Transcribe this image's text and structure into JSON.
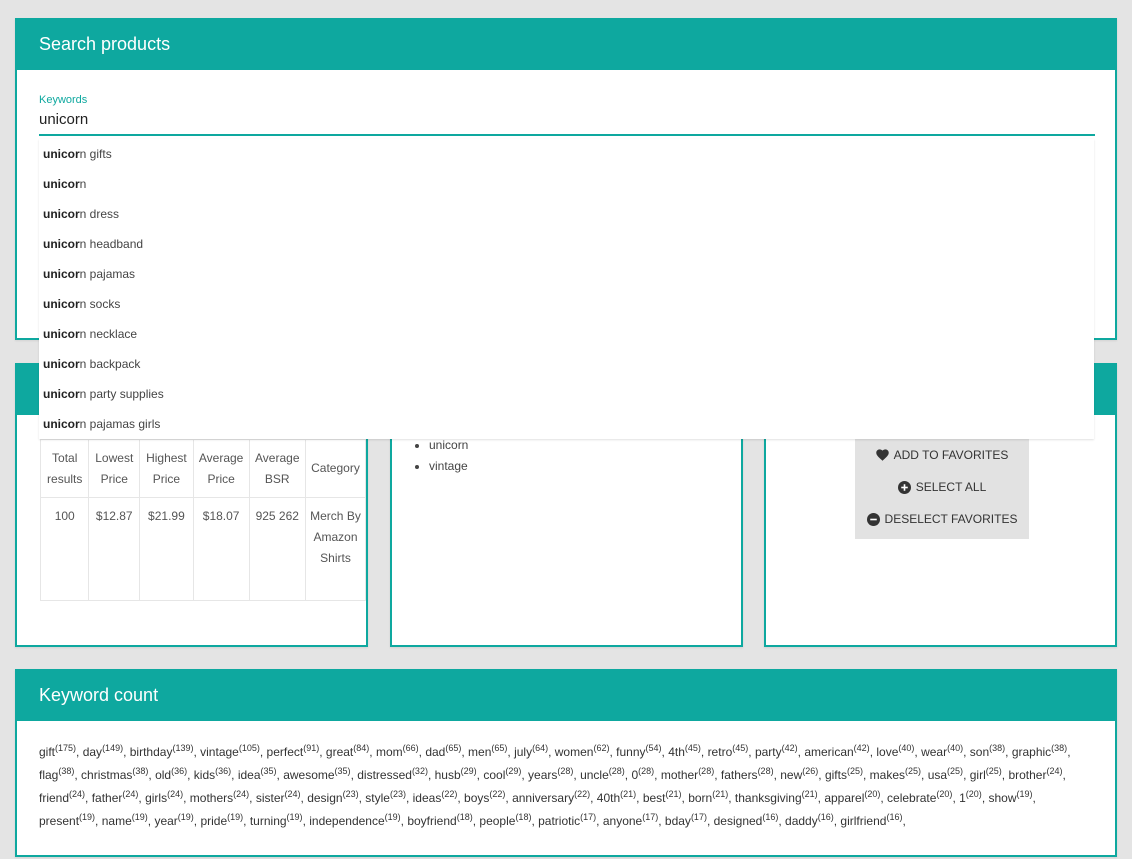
{
  "search": {
    "title": "Search products",
    "keywords_label": "Keywords",
    "value": "unicorn",
    "match": "unicor",
    "suggestions": [
      "n gifts",
      "n",
      "n dress",
      "n headband",
      "n pajamas",
      "n socks",
      "n necklace",
      "n backpack",
      "n party supplies",
      "n pajamas girls"
    ]
  },
  "stats": {
    "headers": [
      "Total results",
      "Lowest Price",
      "Highest Price",
      "Average Price",
      "Average BSR",
      "Category"
    ],
    "values": [
      "100",
      "$12.87",
      "$21.99",
      "$18.07",
      "925 262",
      "Merch By Amazon Shirts"
    ]
  },
  "tags": [
    "unicorn",
    "vintage"
  ],
  "actions": {
    "add_favorites": "ADD TO FAVORITES",
    "select_all": "SELECT ALL",
    "deselect_favorites": "DESELECT FAVORITES"
  },
  "keyword_count": {
    "title": "Keyword count",
    "items": [
      [
        "gift",
        "175"
      ],
      [
        "day",
        "149"
      ],
      [
        "birthday",
        "139"
      ],
      [
        "vintage",
        "105"
      ],
      [
        "perfect",
        "91"
      ],
      [
        "great",
        "84"
      ],
      [
        "mom",
        "66"
      ],
      [
        "dad",
        "65"
      ],
      [
        "men",
        "65"
      ],
      [
        "july",
        "64"
      ],
      [
        "women",
        "62"
      ],
      [
        "funny",
        "54"
      ],
      [
        "4th",
        "45"
      ],
      [
        "retro",
        "45"
      ],
      [
        "party",
        "42"
      ],
      [
        "american",
        "42"
      ],
      [
        "love",
        "40"
      ],
      [
        "wear",
        "40"
      ],
      [
        "son",
        "38"
      ],
      [
        "graphic",
        "38"
      ],
      [
        "flag",
        "38"
      ],
      [
        "christmas",
        "38"
      ],
      [
        "old",
        "36"
      ],
      [
        "kids",
        "36"
      ],
      [
        "idea",
        "35"
      ],
      [
        "awesome",
        "35"
      ],
      [
        "distressed",
        "32"
      ],
      [
        "husb",
        "29"
      ],
      [
        "cool",
        "29"
      ],
      [
        "years",
        "28"
      ],
      [
        "uncle",
        "28"
      ],
      [
        "0",
        "28"
      ],
      [
        "mother",
        "28"
      ],
      [
        "fathers",
        "28"
      ],
      [
        "new",
        "26"
      ],
      [
        "gifts",
        "25"
      ],
      [
        "makes",
        "25"
      ],
      [
        "usa",
        "25"
      ],
      [
        "girl",
        "25"
      ],
      [
        "brother",
        "24"
      ],
      [
        "friend",
        "24"
      ],
      [
        "father",
        "24"
      ],
      [
        "girls",
        "24"
      ],
      [
        "mothers",
        "24"
      ],
      [
        "sister",
        "24"
      ],
      [
        "design",
        "23"
      ],
      [
        "style",
        "23"
      ],
      [
        "ideas",
        "22"
      ],
      [
        "boys",
        "22"
      ],
      [
        "anniversary",
        "22"
      ],
      [
        "40th",
        "21"
      ],
      [
        "best",
        "21"
      ],
      [
        "born",
        "21"
      ],
      [
        "thanksgiving",
        "21"
      ],
      [
        "apparel",
        "20"
      ],
      [
        "celebrate",
        "20"
      ],
      [
        "1",
        "20"
      ],
      [
        "show",
        "19"
      ],
      [
        "present",
        "19"
      ],
      [
        "name",
        "19"
      ],
      [
        "year",
        "19"
      ],
      [
        "pride",
        "19"
      ],
      [
        "turning",
        "19"
      ],
      [
        "independence",
        "19"
      ],
      [
        "boyfriend",
        "18"
      ],
      [
        "people",
        "18"
      ],
      [
        "patriotic",
        "17"
      ],
      [
        "anyone",
        "17"
      ],
      [
        "bday",
        "17"
      ],
      [
        "designed",
        "16"
      ],
      [
        "daddy",
        "16"
      ],
      [
        "girlfriend",
        "16"
      ]
    ]
  },
  "colors": {
    "accent": "#0ea89f",
    "background": "#e4e4e4",
    "panel": "#e2e2e2"
  },
  "icons": {
    "add_favorites": "heart-icon",
    "select_all": "plus-circle-icon",
    "deselect_favorites": "minus-circle-icon"
  }
}
